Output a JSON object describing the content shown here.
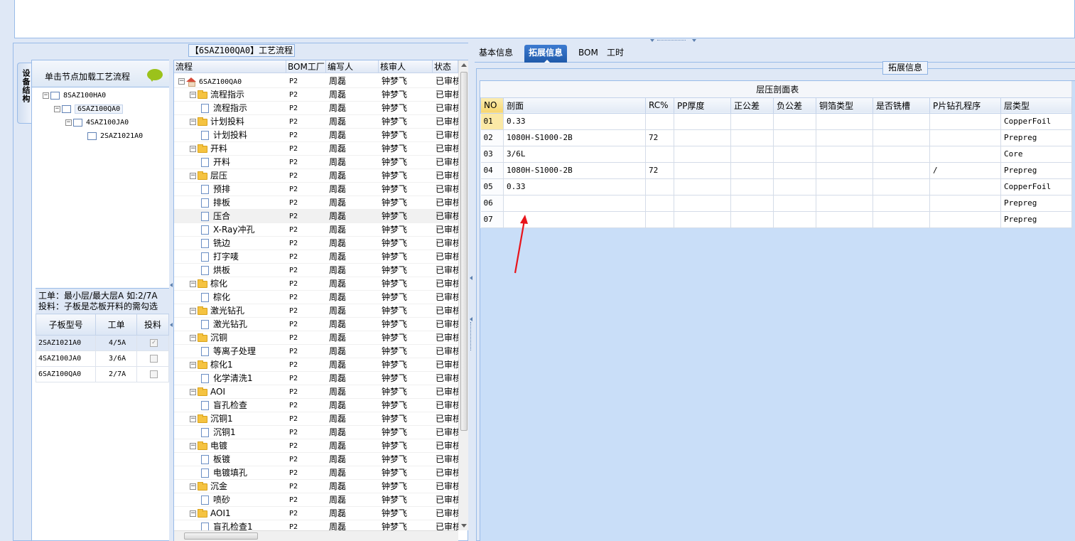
{
  "left_group_title": "【6SAZ100QA0】工艺流程",
  "vertical_tab": "设备结构",
  "struct_header": "单击节点加载工艺流程",
  "struct_tree": [
    {
      "code": "8SAZ100HA0"
    },
    {
      "code": "6SAZ100QA0"
    },
    {
      "code": "4SAZ100JA0"
    },
    {
      "code": "2SAZ1021A0"
    }
  ],
  "note_line1": "工单：最小层/最大层A 如:2/7A",
  "note_line2": "投料：子板是芯板开料的需勾选",
  "subboard_table": {
    "headers": [
      "子板型号",
      "工单",
      "投料"
    ],
    "rows": [
      {
        "model": "2SAZ1021A0",
        "order": "4/5A",
        "checked": true
      },
      {
        "model": "4SAZ100JA0",
        "order": "3/6A",
        "checked": false
      },
      {
        "model": "6SAZ100QA0",
        "order": "2/7A",
        "checked": false
      }
    ]
  },
  "flow_grid": {
    "headers": [
      "流程",
      "BOM工厂",
      "编写人",
      "核审人",
      "状态"
    ],
    "root": "6SAZ100QA0",
    "factory": "P2",
    "author": "周磊",
    "reviewer": "钟梦飞",
    "status": "已审核",
    "rows": [
      {
        "level": 1,
        "name": "流程指示"
      },
      {
        "level": 2,
        "name": "流程指示"
      },
      {
        "level": 1,
        "name": "计划投料"
      },
      {
        "level": 2,
        "name": "计划投料"
      },
      {
        "level": 1,
        "name": "开料"
      },
      {
        "level": 2,
        "name": "开料"
      },
      {
        "level": 1,
        "name": "层压"
      },
      {
        "level": 2,
        "name": "预排"
      },
      {
        "level": 2,
        "name": "排板"
      },
      {
        "level": 2,
        "name": "压合"
      },
      {
        "level": 2,
        "name": "X-Ray冲孔"
      },
      {
        "level": 2,
        "name": "铣边"
      },
      {
        "level": 2,
        "name": "打字唛"
      },
      {
        "level": 2,
        "name": "烘板"
      },
      {
        "level": 1,
        "name": "棕化"
      },
      {
        "level": 2,
        "name": "棕化"
      },
      {
        "level": 1,
        "name": "激光钻孔"
      },
      {
        "level": 2,
        "name": "激光钻孔"
      },
      {
        "level": 1,
        "name": "沉铜"
      },
      {
        "level": 2,
        "name": "等离子处理"
      },
      {
        "level": 1,
        "name": "棕化1"
      },
      {
        "level": 2,
        "name": "化学清洗1"
      },
      {
        "level": 1,
        "name": "AOI"
      },
      {
        "level": 2,
        "name": "盲孔检查"
      },
      {
        "level": 1,
        "name": "沉铜1"
      },
      {
        "level": 2,
        "name": "沉铜1"
      },
      {
        "level": 1,
        "name": "电镀"
      },
      {
        "level": 2,
        "name": "板镀"
      },
      {
        "level": 2,
        "name": "电镀填孔"
      },
      {
        "level": 1,
        "name": "沉金"
      },
      {
        "level": 2,
        "name": "喷砂"
      },
      {
        "level": 1,
        "name": "AOI1"
      },
      {
        "level": 2,
        "name": "盲孔检查1"
      }
    ],
    "selected_index": 9
  },
  "tabs": [
    "基本信息",
    "拓展信息",
    "BOM",
    "工时"
  ],
  "active_tab": 1,
  "ext_legend": "拓展信息",
  "stack_table": {
    "caption": "层压剖面表",
    "headers": [
      "NO",
      "剖面",
      "RC%",
      "PP厚度",
      "正公差",
      "负公差",
      "铜箔类型",
      "是否铣槽",
      "P片钻孔程序",
      "层类型"
    ],
    "rows": [
      [
        "01",
        "0.33",
        "",
        "",
        "",
        "",
        "",
        "",
        "",
        "CopperFoil"
      ],
      [
        "02",
        "1080H-S1000-2B",
        "72",
        "",
        "",
        "",
        "",
        "",
        "",
        "Prepreg"
      ],
      [
        "03",
        "3/6L",
        "",
        "",
        "",
        "",
        "",
        "",
        "",
        "Core"
      ],
      [
        "04",
        "1080H-S1000-2B",
        "72",
        "",
        "",
        "",
        "",
        "",
        "/",
        "Prepreg"
      ],
      [
        "05",
        "0.33",
        "",
        "",
        "",
        "",
        "",
        "",
        "",
        "CopperFoil"
      ],
      [
        "06",
        "",
        "",
        "",
        "",
        "",
        "",
        "",
        "",
        "Prepreg"
      ],
      [
        "07",
        "",
        "",
        "",
        "",
        "",
        "",
        "",
        "",
        "Prepreg"
      ]
    ]
  },
  "colors": {
    "accent": "#1f5aaa",
    "annotation": "#e8141b",
    "folder": "#f5c341"
  }
}
